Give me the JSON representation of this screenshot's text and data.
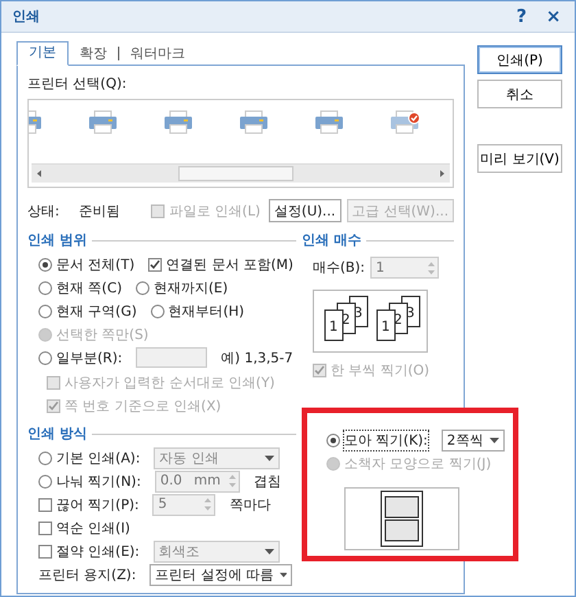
{
  "window": {
    "title": "인쇄",
    "help": "?",
    "close": "×"
  },
  "tabs": [
    {
      "label": "기본",
      "selected": true
    },
    {
      "label": "확장",
      "selected": false
    },
    {
      "label": "워터마크",
      "selected": false
    }
  ],
  "printer_select": {
    "label": "프린터 선택(Q):",
    "printers": [
      {
        "selected": false
      },
      {
        "selected": false
      },
      {
        "selected": false
      },
      {
        "selected": false
      },
      {
        "selected": false
      },
      {
        "selected": true
      }
    ]
  },
  "status": {
    "label": "상태:",
    "value": "준비됨"
  },
  "print_to_file": {
    "label": "파일로 인쇄(L)",
    "checked": false,
    "disabled": true
  },
  "setup_buttons": [
    {
      "label": "설정(U)...",
      "disabled": false
    },
    {
      "label": "고급 선택(W)...",
      "disabled": true
    }
  ],
  "print_range": {
    "title": "인쇄 범위",
    "rows": [
      [
        {
          "kind": "radio",
          "label": "문서 전체(T)",
          "selected": true,
          "disabled": false
        },
        {
          "kind": "checkbox",
          "label": "연결된 문서 포함(M)",
          "checked": true,
          "disabled": false
        }
      ],
      [
        {
          "kind": "radio",
          "label": "현재 쪽(C)",
          "selected": false,
          "disabled": false
        },
        {
          "kind": "radio",
          "label": "현재까지(E)",
          "selected": false,
          "disabled": false
        }
      ],
      [
        {
          "kind": "radio",
          "label": "현재 구역(G)",
          "selected": false,
          "disabled": false
        },
        {
          "kind": "radio",
          "label": "현재부터(H)",
          "selected": false,
          "disabled": false
        }
      ],
      [
        {
          "kind": "radio",
          "label": "선택한 쪽만(S)",
          "selected": false,
          "disabled": true
        }
      ],
      [
        {
          "kind": "radio",
          "label": "일부분(R):",
          "selected": false,
          "disabled": false
        },
        {
          "kind": "field",
          "disabled": true
        },
        {
          "kind": "text",
          "label": "예) 1,3,5-7",
          "disabled": false
        }
      ]
    ],
    "sub_rows": [
      [
        {
          "kind": "checkbox",
          "label": "사용자가 입력한 순서대로 인쇄(Y)",
          "checked": false,
          "disabled": true
        }
      ],
      [
        {
          "kind": "checkbox",
          "label": "쪽 번호 기준으로 인쇄(X)",
          "checked": true,
          "disabled": true
        }
      ]
    ]
  },
  "copies": {
    "title": "인쇄 매수",
    "label": "매수(B):",
    "value": "1",
    "disabled": true,
    "stacks": [
      [
        "1",
        "2",
        "3"
      ],
      [
        "1",
        "2",
        "3"
      ]
    ],
    "collate": {
      "label": "한 부씩 찍기(O)",
      "checked": true,
      "disabled": true
    }
  },
  "print_method": {
    "title": "인쇄 방식",
    "rows": [
      [
        {
          "kind": "radio",
          "label": "기본 인쇄(A):",
          "selected": false,
          "disabled": false
        },
        {
          "kind": "dropdown",
          "value": "자동 인쇄",
          "disabled": true
        }
      ],
      [
        {
          "kind": "radio",
          "label": "나눠 찍기(N):",
          "selected": false,
          "disabled": false
        },
        {
          "kind": "spinner",
          "value": "0.0",
          "unit": "mm",
          "disabled": true
        },
        {
          "kind": "text",
          "label": "겹침",
          "disabled": false
        }
      ],
      [
        {
          "kind": "checkbox",
          "label": "끊어 찍기(P):",
          "checked": false,
          "disabled": false
        },
        {
          "kind": "spinner",
          "value": "5",
          "disabled": true
        },
        {
          "kind": "text",
          "label": "쪽마다",
          "disabled": false
        }
      ],
      [
        {
          "kind": "checkbox",
          "label": "역순 인쇄(I)",
          "checked": false,
          "disabled": false
        }
      ],
      [
        {
          "kind": "checkbox",
          "label": "절약 인쇄(E):",
          "checked": false,
          "disabled": false
        },
        {
          "kind": "dropdown",
          "value": "회색조",
          "disabled": true
        }
      ],
      [
        {
          "kind": "text",
          "label": "프린터 용지(Z):",
          "disabled": false
        },
        {
          "kind": "dropdown",
          "value": "프린터 설정에 따름",
          "disabled": false
        }
      ]
    ]
  },
  "n_up": {
    "highlighted": true,
    "rows": [
      [
        {
          "kind": "radio",
          "label": "모아 찍기(K):",
          "selected": true,
          "disabled": false,
          "focused": true
        },
        {
          "kind": "dropdown",
          "value": "2쪽씩",
          "disabled": false
        }
      ],
      [
        {
          "kind": "radio",
          "label": "소책자 모양으로 찍기(J)",
          "selected": false,
          "disabled": true
        }
      ]
    ]
  },
  "side_buttons": [
    {
      "label": "인쇄(P)",
      "default": true
    },
    {
      "label": "취소",
      "default": false
    },
    {
      "label": "미리 보기(V)",
      "default": false
    }
  ]
}
